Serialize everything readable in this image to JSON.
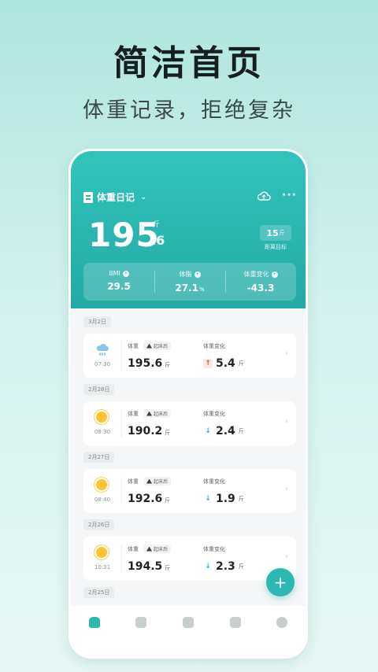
{
  "promo": {
    "title": "简洁首页",
    "subtitle": "体重记录，拒绝复杂"
  },
  "header": {
    "app_title": "体重日记",
    "weight_int": "195",
    "weight_dec": ".6",
    "weight_unit": "斤",
    "goal_value": "15",
    "goal_unit": "斤",
    "goal_label": "距离目标"
  },
  "stats": [
    {
      "label": "BMI",
      "badge": "•",
      "value": "29.5",
      "unit": ""
    },
    {
      "label": "体脂",
      "badge": "•",
      "value": "27.1",
      "unit": "%"
    },
    {
      "label": "体重变化",
      "badge": "•",
      "value": "-43.3",
      "unit": ""
    }
  ],
  "labels": {
    "weight": "体重",
    "change": "体重变化",
    "tag": "起床后",
    "unit": "斤"
  },
  "records": [
    {
      "date": "3月2日",
      "weather": "rain-icon",
      "time": "07:30",
      "weight": "195.6",
      "change": "5.4",
      "direction": "up"
    },
    {
      "date": "2月28日",
      "weather": "sun-icon",
      "time": "08:30",
      "weight": "190.2",
      "change": "2.4",
      "direction": "down"
    },
    {
      "date": "2月27日",
      "weather": "sun-icon",
      "time": "08:40",
      "weight": "192.6",
      "change": "1.9",
      "direction": "down"
    },
    {
      "date": "2月26日",
      "weather": "sun-icon",
      "time": "10:31",
      "weight": "194.5",
      "change": "2.3",
      "direction": "down"
    }
  ],
  "next_date": "2月25日",
  "fab_label": "+",
  "tabs": [
    {
      "icon": "home-icon",
      "active": true
    },
    {
      "icon": "chart-icon",
      "active": false
    },
    {
      "icon": "calendar-icon",
      "active": false
    },
    {
      "icon": "book-icon",
      "active": false
    },
    {
      "icon": "profile-icon",
      "active": false
    }
  ],
  "colors": {
    "accent": "#2bb8b1",
    "up": "#e4554a",
    "down": "#34a7d8"
  }
}
